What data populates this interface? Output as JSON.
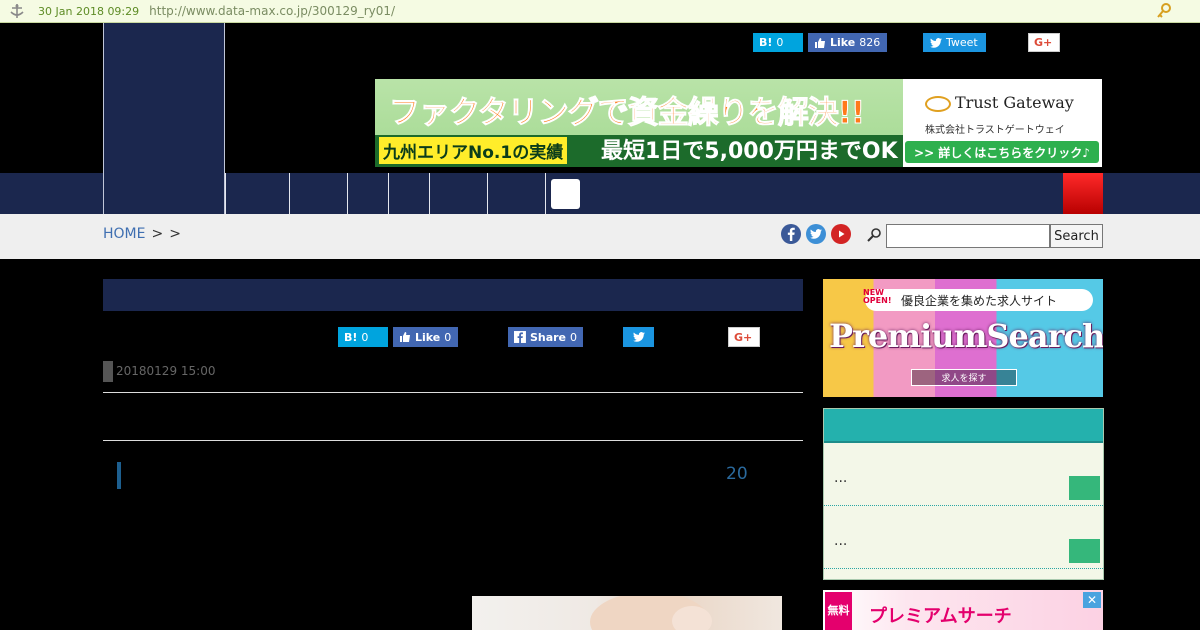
{
  "archive_bar": {
    "date": "30 Jan 2018 09:29",
    "url": "http://www.data-max.co.jp/300129_ry01/"
  },
  "header": {
    "share": {
      "hatena_label": "B!",
      "hatena_count": "0",
      "fb_label": "Like",
      "fb_count": "826",
      "tweet_label": "Tweet",
      "gplus_label": "G+"
    }
  },
  "ad_banner": {
    "headline": "ファクタリングで資金繰りを解決!!",
    "badge": "九州エリアNo.1の実績",
    "subline": "最短1日で5,000万円までOK",
    "brand": "Trust Gateway",
    "company": "株式会社トラストゲートウェイ",
    "cta": ">> 詳しくはこちらをクリック♪"
  },
  "breadcrumb": {
    "home": "HOME",
    "sep1": ">",
    "sep2": ">"
  },
  "search": {
    "placeholder": "",
    "button_label": "Search"
  },
  "article": {
    "share": {
      "hatena_label": "B!",
      "hatena_count": "0",
      "fb_like_label": "Like",
      "fb_like_count": "0",
      "fb_share_label": "Share",
      "fb_share_count": "0",
      "gplus_label": "G+"
    },
    "date": "20180129 15:00",
    "subhead_number": "20"
  },
  "sidebar": {
    "premium_ad": {
      "new_label": "NEW OPEN!",
      "tagline": "優良企業を集めた求人サイト",
      "title": "PremiumSearch",
      "button": "求人を探す"
    },
    "widget": {
      "rows": [
        {
          "text": "..."
        },
        {
          "text": "..."
        }
      ]
    },
    "premium_ad2": {
      "tag": "無料",
      "text": "プレミアムサーチ",
      "close": "✕"
    }
  },
  "colors": {
    "navy": "#1b274e",
    "teal": "#24b1ad",
    "green_button": "#35b77b",
    "link_blue": "#3f6fb1"
  }
}
